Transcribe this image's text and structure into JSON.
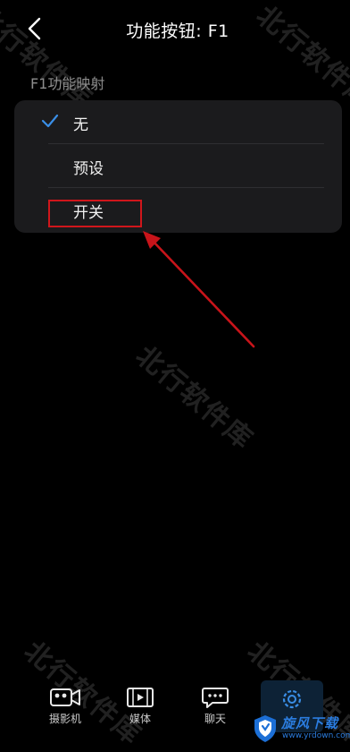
{
  "header": {
    "title": "功能按钮: F1",
    "back_icon": "chevron-left-icon"
  },
  "section": {
    "label": "F1功能映射"
  },
  "options": [
    {
      "label": "无",
      "selected": true
    },
    {
      "label": "预设",
      "selected": false
    },
    {
      "label": "开关",
      "selected": false
    }
  ],
  "colors": {
    "accent": "#3a8ee6",
    "annotation": "#d0161b",
    "card": "#1b1b1d"
  },
  "watermark": {
    "text": "北行软件库"
  },
  "nav": [
    {
      "label": "摄影机",
      "icon": "camera-icon"
    },
    {
      "label": "媒体",
      "icon": "film-icon"
    },
    {
      "label": "聊天",
      "icon": "chat-icon"
    },
    {
      "label": "",
      "icon": "gear-icon",
      "active": true
    }
  ],
  "brand": {
    "name": "旋风下载",
    "url": "www.yrdown.com",
    "icon": "shield-logo-icon"
  }
}
